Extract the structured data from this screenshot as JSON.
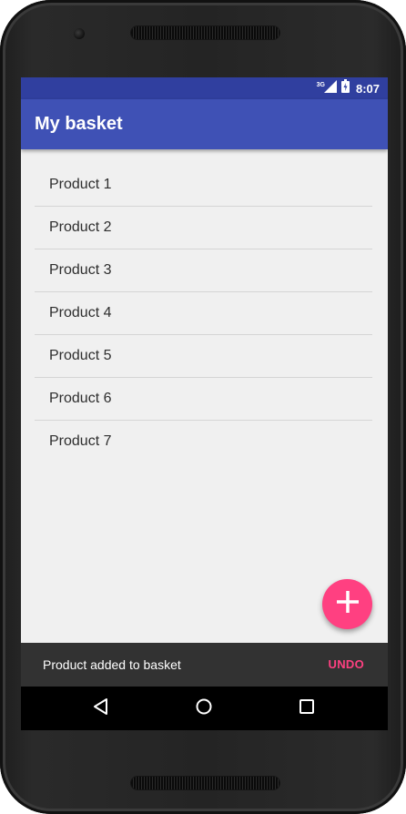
{
  "status_bar": {
    "network": "3G",
    "time": "8:07"
  },
  "app_bar": {
    "title": "My basket"
  },
  "products": [
    {
      "label": "Product 1"
    },
    {
      "label": "Product 2"
    },
    {
      "label": "Product 3"
    },
    {
      "label": "Product 4"
    },
    {
      "label": "Product 5"
    },
    {
      "label": "Product 6"
    },
    {
      "label": "Product 7"
    }
  ],
  "fab": {
    "icon": "plus-icon"
  },
  "snackbar": {
    "message": "Product added to basket",
    "action": "UNDO"
  },
  "nav_bar": {
    "icons": [
      "back-icon",
      "home-icon",
      "recents-icon"
    ]
  },
  "colors": {
    "primary": "#3f51b5",
    "primary_dark": "#303f9f",
    "accent": "#ff4081",
    "background": "#f0f0f0",
    "snackbar": "#323232"
  }
}
